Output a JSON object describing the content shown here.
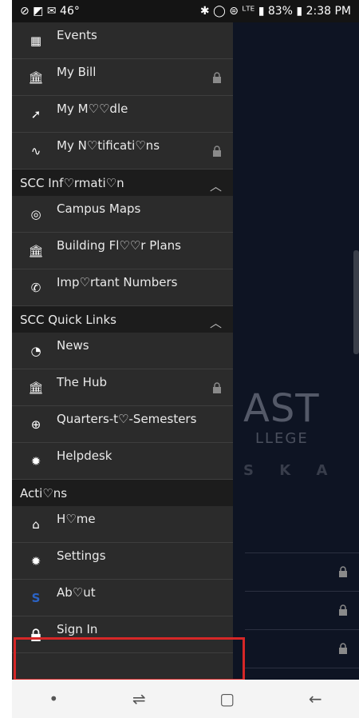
{
  "status": {
    "left_icons": "⊘ ◩ ✉ 46°",
    "right_text": "✱ ◯ ⊜ ᴸᵀᴱ ▮ 83% ▮ 2:38 PM"
  },
  "background": {
    "logo_text": "AST",
    "sub1": "LLEGE",
    "sub2": "S K A"
  },
  "menu": {
    "items_top": [
      {
        "label": "Events",
        "icon": "calendar-icon"
      },
      {
        "label": "My Bill",
        "icon": "bank-icon",
        "locked": true
      },
      {
        "label": "My M♡♡dle",
        "icon": "rocket-icon"
      },
      {
        "label": "My N♡tificati♡ns",
        "icon": "pulse-icon",
        "locked": true
      }
    ],
    "section_info": "SCC Inf♡rmati♡n",
    "items_info": [
      {
        "label": "Campus Maps",
        "icon": "compass-icon"
      },
      {
        "label": "Building Fl♡♡r Plans",
        "icon": "building-icon"
      },
      {
        "label": "Imp♡rtant Numbers",
        "icon": "phone-icon"
      }
    ],
    "section_links": "SCC Quick Links",
    "items_links": [
      {
        "label": "News",
        "icon": "rss-icon"
      },
      {
        "label": "The Hub",
        "icon": "building-icon",
        "locked": true
      },
      {
        "label": "Quarters-t♡-Semesters",
        "icon": "globe-icon"
      },
      {
        "label": "Helpdesk",
        "icon": "gear-icon"
      }
    ],
    "section_actions": "Acti♡ns",
    "items_actions": [
      {
        "label": "H♡me",
        "icon": "home-icon"
      },
      {
        "label": "Settings",
        "icon": "gear-icon"
      },
      {
        "label": "Ab♡ut",
        "icon": "s-logo-icon"
      },
      {
        "label": "Sign In",
        "icon": "lock-icon"
      }
    ]
  }
}
